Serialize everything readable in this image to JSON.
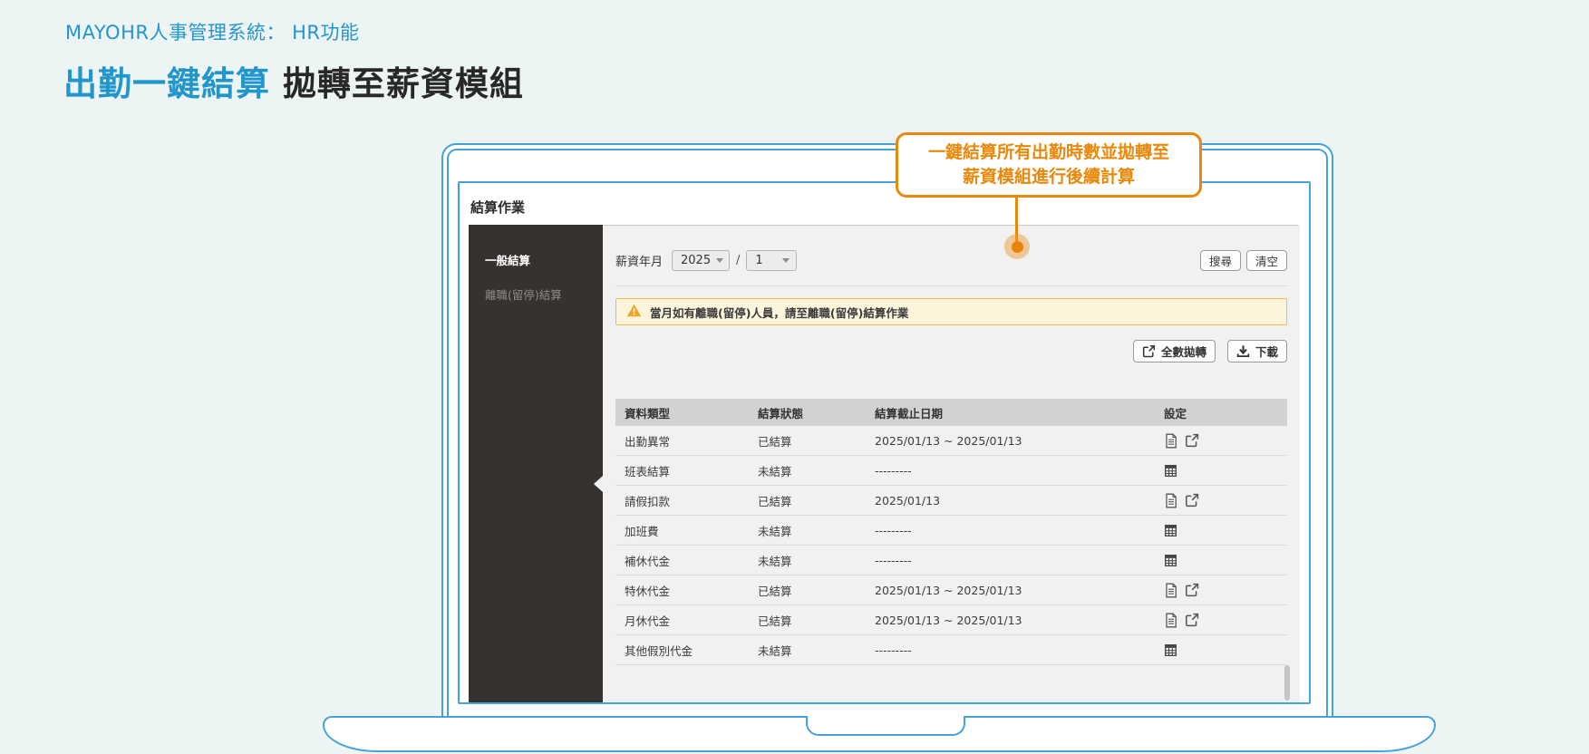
{
  "page": {
    "eyebrow": "MAYOHR人事管理系統： HR功能",
    "title": {
      "highlight": "出勤一鍵結算",
      "rest": " 拋轉至薪資模組"
    }
  },
  "callout": {
    "line1": "一鍵結算所有出勤時數並拋轉至",
    "line2": "薪資模組進行後續計算"
  },
  "app": {
    "window_title": "結算作業",
    "sidebar": {
      "items": [
        {
          "label": "一般結算",
          "active": true
        },
        {
          "label": "離職(留停)結算",
          "active": false
        }
      ]
    },
    "filter": {
      "label": "薪資年月",
      "year": "2025",
      "separator": "/",
      "month": "1",
      "search": "搜尋",
      "clear": "清空"
    },
    "notice": {
      "icon": "warning-icon",
      "text": "當月如有離職(留停)人員，請至離職(留停)結算作業"
    },
    "actions": {
      "transfer": {
        "icon": "export-icon",
        "label": "全數拋轉"
      },
      "download": {
        "icon": "download-icon",
        "label": "下載"
      }
    },
    "table": {
      "headers": [
        "資料類型",
        "結算狀態",
        "結算截止日期",
        "設定"
      ],
      "rows": [
        {
          "type": "出勤異常",
          "status": "已結算",
          "deadline": "2025/01/13 ~ 2025/01/13",
          "icons": [
            "document",
            "export"
          ]
        },
        {
          "type": "班表結算",
          "status": "未結算",
          "deadline": "---------",
          "icons": [
            "calculator"
          ]
        },
        {
          "type": "請假扣款",
          "status": "已結算",
          "deadline": "2025/01/13",
          "icons": [
            "document",
            "export"
          ]
        },
        {
          "type": "加班費",
          "status": "未結算",
          "deadline": "---------",
          "icons": [
            "calculator"
          ]
        },
        {
          "type": "補休代金",
          "status": "未結算",
          "deadline": "---------",
          "icons": [
            "calculator"
          ]
        },
        {
          "type": "特休代金",
          "status": "已結算",
          "deadline": "2025/01/13 ~ 2025/01/13",
          "icons": [
            "document",
            "export"
          ]
        },
        {
          "type": "月休代金",
          "status": "已結算",
          "deadline": "2025/01/13 ~ 2025/01/13",
          "icons": [
            "document",
            "export"
          ]
        },
        {
          "type": "其他假別代金",
          "status": "未結算",
          "deadline": "---------",
          "icons": [
            "calculator"
          ]
        }
      ]
    }
  },
  "colors": {
    "page_background": "#edf4f4",
    "accent_blue": "#2196cc",
    "laptop_blue": "#45a2da",
    "callout_orange": "#e8890c",
    "dot_orange": "#e8820a",
    "warning_bg": "#fcf5dc",
    "warning_border": "#e3c04a",
    "sidebar_bg": "#363230",
    "content_bg": "#f1f1f1",
    "table_header_bg": "#d2d2d2"
  }
}
